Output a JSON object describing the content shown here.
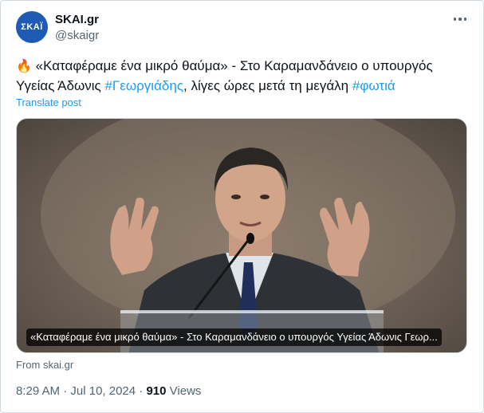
{
  "account": {
    "avatar_text": "ΣΚΑΪ",
    "name": "SKAI.gr",
    "handle": "@skaigr",
    "avatar_color": "#1f5ab4"
  },
  "menu_icon": "more-horizontal-icon",
  "tweet": {
    "emoji": "🔥",
    "text_part1": " «Καταφέραμε ένα μικρό θαύμα» - Στο Καραμανδάνειο ο υπουργός Υγείας Άδωνις ",
    "hashtag1": "#Γεωργιάδης",
    "text_part2": ", λίγες ώρες μετά τη μεγάλη ",
    "hashtag2": "#φωτιά"
  },
  "translate_label": "Translate post",
  "media": {
    "caption": "«Καταφέραμε ένα μικρό θαύμα» - Στο Καραμανδάνειο ο υπουργός Υγείας Άδωνις Γεωρ..."
  },
  "source": "From skai.gr",
  "meta": {
    "time": "8:29 AM",
    "separator": " · ",
    "date": "Jul 10, 2024",
    "views_count": "910",
    "views_label": " Views"
  },
  "colors": {
    "link": "#1d9bf0",
    "secondary_text": "#536471",
    "primary_text": "#0f1419"
  }
}
